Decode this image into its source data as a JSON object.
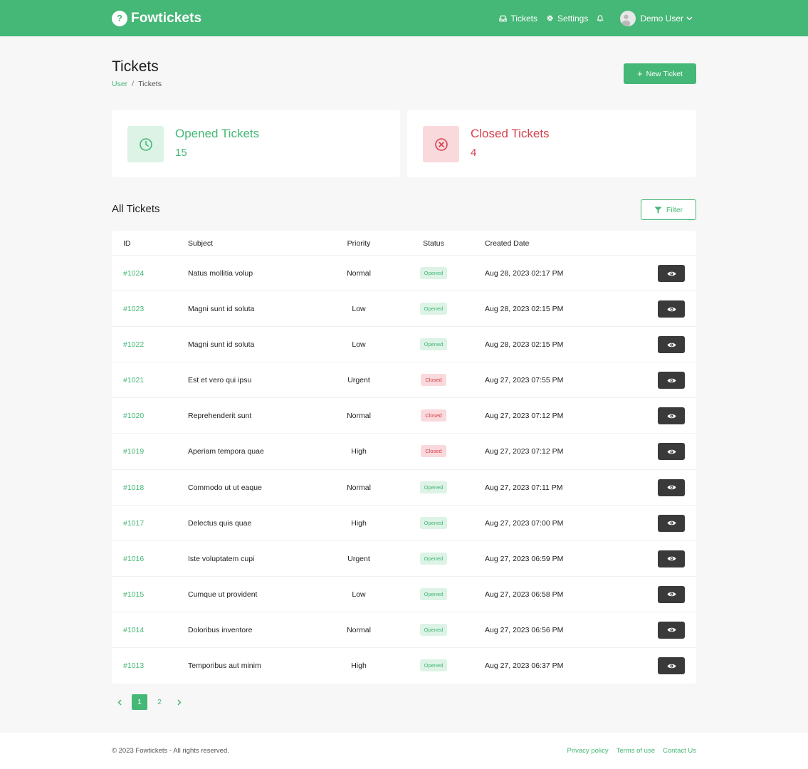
{
  "brand": {
    "name": "Fowtickets"
  },
  "nav": {
    "tickets_label": "Tickets",
    "settings_label": "Settings",
    "user_name": "Demo User"
  },
  "page": {
    "title": "Tickets",
    "breadcrumb": [
      "User",
      "Tickets"
    ],
    "new_ticket_label": "New Ticket"
  },
  "stats": {
    "opened": {
      "label": "Opened Tickets",
      "count": "15"
    },
    "closed": {
      "label": "Closed Tickets",
      "count": "4"
    }
  },
  "section": {
    "title": "All Tickets",
    "filter_label": "Filter"
  },
  "table": {
    "columns": [
      "ID",
      "Subject",
      "Priority",
      "Status",
      "Created Date"
    ],
    "rows": [
      {
        "id": "#1024",
        "subject": "Natus mollitia volup",
        "priority": "Normal",
        "status": "Opened",
        "date": "Aug 28, 2023 02:17 PM"
      },
      {
        "id": "#1023",
        "subject": "Magni sunt id soluta",
        "priority": "Low",
        "status": "Opened",
        "date": "Aug 28, 2023 02:15 PM"
      },
      {
        "id": "#1022",
        "subject": "Magni sunt id soluta",
        "priority": "Low",
        "status": "Opened",
        "date": "Aug 28, 2023 02:15 PM"
      },
      {
        "id": "#1021",
        "subject": "Est et vero qui ipsu",
        "priority": "Urgent",
        "status": "Closed",
        "date": "Aug 27, 2023 07:55 PM"
      },
      {
        "id": "#1020",
        "subject": "Reprehenderit sunt",
        "priority": "Normal",
        "status": "Closed",
        "date": "Aug 27, 2023 07:12 PM"
      },
      {
        "id": "#1019",
        "subject": "Aperiam tempora quae",
        "priority": "High",
        "status": "Closed",
        "date": "Aug 27, 2023 07:12 PM"
      },
      {
        "id": "#1018",
        "subject": "Commodo ut ut eaque",
        "priority": "Normal",
        "status": "Opened",
        "date": "Aug 27, 2023 07:11 PM"
      },
      {
        "id": "#1017",
        "subject": "Delectus quis quae",
        "priority": "High",
        "status": "Opened",
        "date": "Aug 27, 2023 07:00 PM"
      },
      {
        "id": "#1016",
        "subject": "Iste voluptatem cupi",
        "priority": "Urgent",
        "status": "Opened",
        "date": "Aug 27, 2023 06:59 PM"
      },
      {
        "id": "#1015",
        "subject": "Cumque ut provident",
        "priority": "Low",
        "status": "Opened",
        "date": "Aug 27, 2023 06:58 PM"
      },
      {
        "id": "#1014",
        "subject": "Doloribus inventore",
        "priority": "Normal",
        "status": "Opened",
        "date": "Aug 27, 2023 06:56 PM"
      },
      {
        "id": "#1013",
        "subject": "Temporibus aut minim",
        "priority": "High",
        "status": "Opened",
        "date": "Aug 27, 2023 06:37 PM"
      }
    ]
  },
  "pagination": {
    "pages": [
      "1",
      "2"
    ],
    "current": "1"
  },
  "footer": {
    "copyright": "© 2023 Fowtickets - All rights reserved.",
    "links": [
      "Privacy policy",
      "Terms of use",
      "Contact Us"
    ]
  },
  "colors": {
    "brand": "#45b776",
    "danger": "#d4424e",
    "dark_button": "#3a3a3a"
  },
  "icons": {
    "brand": "ticket-logo-icon",
    "tickets": "inbox-icon",
    "settings": "gear-icon",
    "notifications": "bell-icon",
    "user_menu": "chevron-down-icon",
    "opened": "clock-icon",
    "closed": "x-circle-icon",
    "filter": "funnel-icon",
    "view": "eye-icon"
  }
}
